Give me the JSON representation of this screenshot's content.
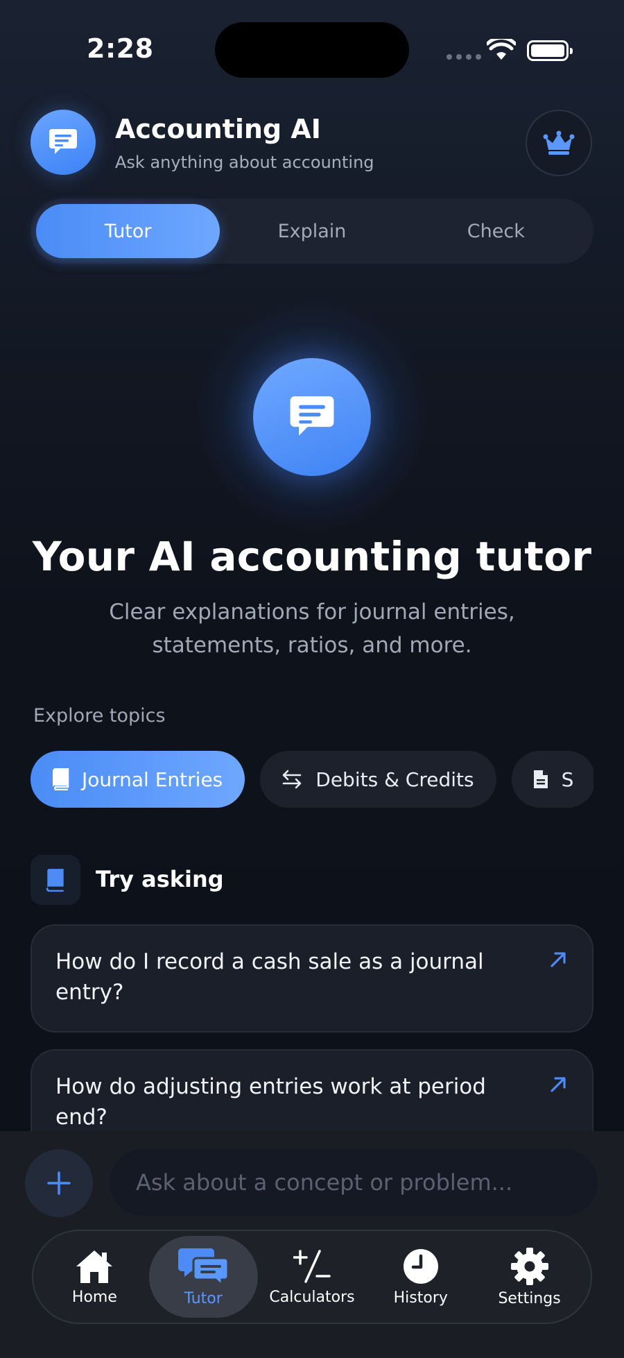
{
  "status": {
    "time": "2:28"
  },
  "header": {
    "title": "Accounting AI",
    "subtitle": "Ask anything about accounting"
  },
  "segments": [
    "Tutor",
    "Explain",
    "Check"
  ],
  "segments_active": "Tutor",
  "hero": {
    "title": "Your AI accounting tutor",
    "subtitle": "Clear explanations for journal entries, statements, ratios, and more."
  },
  "explore": {
    "label": "Explore topics",
    "chips": [
      {
        "label": "Journal Entries",
        "icon": "book-icon",
        "active": true
      },
      {
        "label": "Debits & Credits",
        "icon": "arrows-swap-icon",
        "active": false
      },
      {
        "label": "S",
        "icon": "document-icon",
        "active": false
      }
    ]
  },
  "try_asking": {
    "label": "Try asking",
    "questions": [
      "How do I record a cash sale as a journal entry?",
      "How do adjusting entries work at period end?"
    ]
  },
  "composer": {
    "placeholder": "Ask about a concept or problem..."
  },
  "tabbar": {
    "items": [
      {
        "label": "Home",
        "icon": "home-icon"
      },
      {
        "label": "Tutor",
        "icon": "chat-bubbles-icon",
        "active": true
      },
      {
        "label": "Calculators",
        "icon": "calculator-icon"
      },
      {
        "label": "History",
        "icon": "clock-icon"
      },
      {
        "label": "Settings",
        "icon": "gear-icon"
      }
    ]
  },
  "colors": {
    "accent": "#4a8cf6",
    "accent_light": "#6ea7ff",
    "background": "#0e121b",
    "active_tab_text": "#5a98ff"
  }
}
